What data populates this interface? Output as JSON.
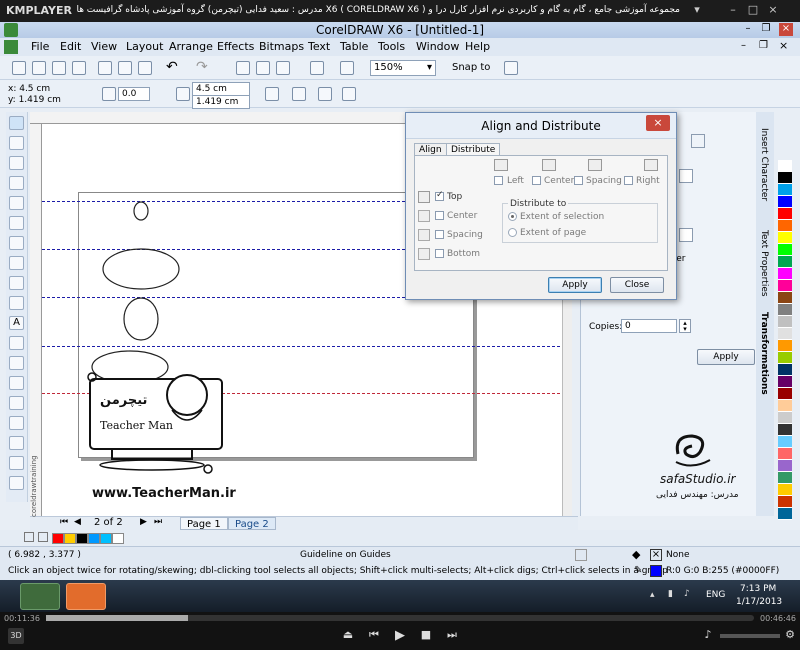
{
  "player": {
    "brand": "KMPLAYER",
    "title": "مجموعه آموزشی جامع ، گام به گام و کاربردی نرم افزار کارل درا و X6 ( CORELDRAW X6 ) مدرس : سعید فدایی (تیچرمن) گروه آموزشی پادشاه گرافیست ها",
    "elapsed": "00:11:36",
    "remaining": "00:46:46",
    "progress_percent": 20
  },
  "window": {
    "title": "CorelDRAW X6 - [Untitled-1]"
  },
  "menu": [
    "File",
    "Edit",
    "View",
    "Layout",
    "Arrange",
    "Effects",
    "Bitmaps",
    "Text",
    "Table",
    "Tools",
    "Window",
    "Help"
  ],
  "toolbar": {
    "zoom": "150%",
    "snap_to": "Snap to"
  },
  "property_bar": {
    "x": "x: 4.5 cm",
    "y": "y: 1.419 cm",
    "angle": "0.0",
    "x2": "4.5 cm",
    "y2": "1.419 cm"
  },
  "dialog": {
    "title": "Align and Distribute",
    "tab_align": "Align",
    "tab_distribute": "Distribute",
    "top_options": {
      "left": "Left",
      "center": "Center",
      "spacing": "Spacing",
      "right": "Right"
    },
    "side_options": {
      "top": "Top",
      "center": "Center",
      "spacing": "Spacing",
      "bottom": "Bottom"
    },
    "distribute_to_label": "Distribute to",
    "extent_selection": "Extent of selection",
    "extent_page": "Extent of page",
    "apply": "Apply",
    "close": "Close"
  },
  "docker": {
    "copies_label": "Copies:",
    "copies_value": "0",
    "apply": "Apply",
    "center_fragment": "nter",
    "tabs": [
      "Insert Character",
      "Text Properties",
      "Transformations"
    ]
  },
  "canvas": {
    "website": "www.TeacherMan.ir",
    "logo_latin": "Teacher Man",
    "logo_persian": "تیچرمن",
    "studio": "safaStudio.ir",
    "studio_credit": "مدرس: مهندس فدایی"
  },
  "pages": {
    "counter": "2 of 2",
    "page1": "Page 1",
    "page2": "Page 2",
    "side_label": "coreldrawtraining"
  },
  "status": {
    "coords": "( 6.982 , 3.377 )",
    "object": "Guideline on Guides",
    "fill": "None",
    "hint": "Click an object twice for rotating/skewing; dbl-clicking tool selects all objects; Shift+click multi-selects; Alt+click digs; Ctrl+click selects in a group",
    "outline_color": "R:0 G:0 B:255 (#0000FF)"
  },
  "taskbar": {
    "lang": "ENG",
    "time": "7:13 PM",
    "date": "1/17/2013"
  },
  "colors": {
    "palette": [
      "#ffffff",
      "#000000",
      "#00a0e9",
      "#0000ff",
      "#ff0000",
      "#ff6600",
      "#ffff00",
      "#00ff00",
      "#00a651",
      "#ff00ff",
      "#ff0099",
      "#8b4513",
      "#808080",
      "#c0c0c0",
      "#e0e0e0",
      "#ff9900",
      "#99cc00",
      "#003366",
      "#660066",
      "#990000",
      "#ffcc99",
      "#cccccc",
      "#333333",
      "#66ccff",
      "#ff6666",
      "#9966cc",
      "#339966",
      "#ffcc00",
      "#cc3300",
      "#006699"
    ],
    "strip": [
      "#ff0000",
      "#ffcc00",
      "#000000",
      "#0099ff",
      "#00c0ff",
      "#ffffff"
    ]
  }
}
